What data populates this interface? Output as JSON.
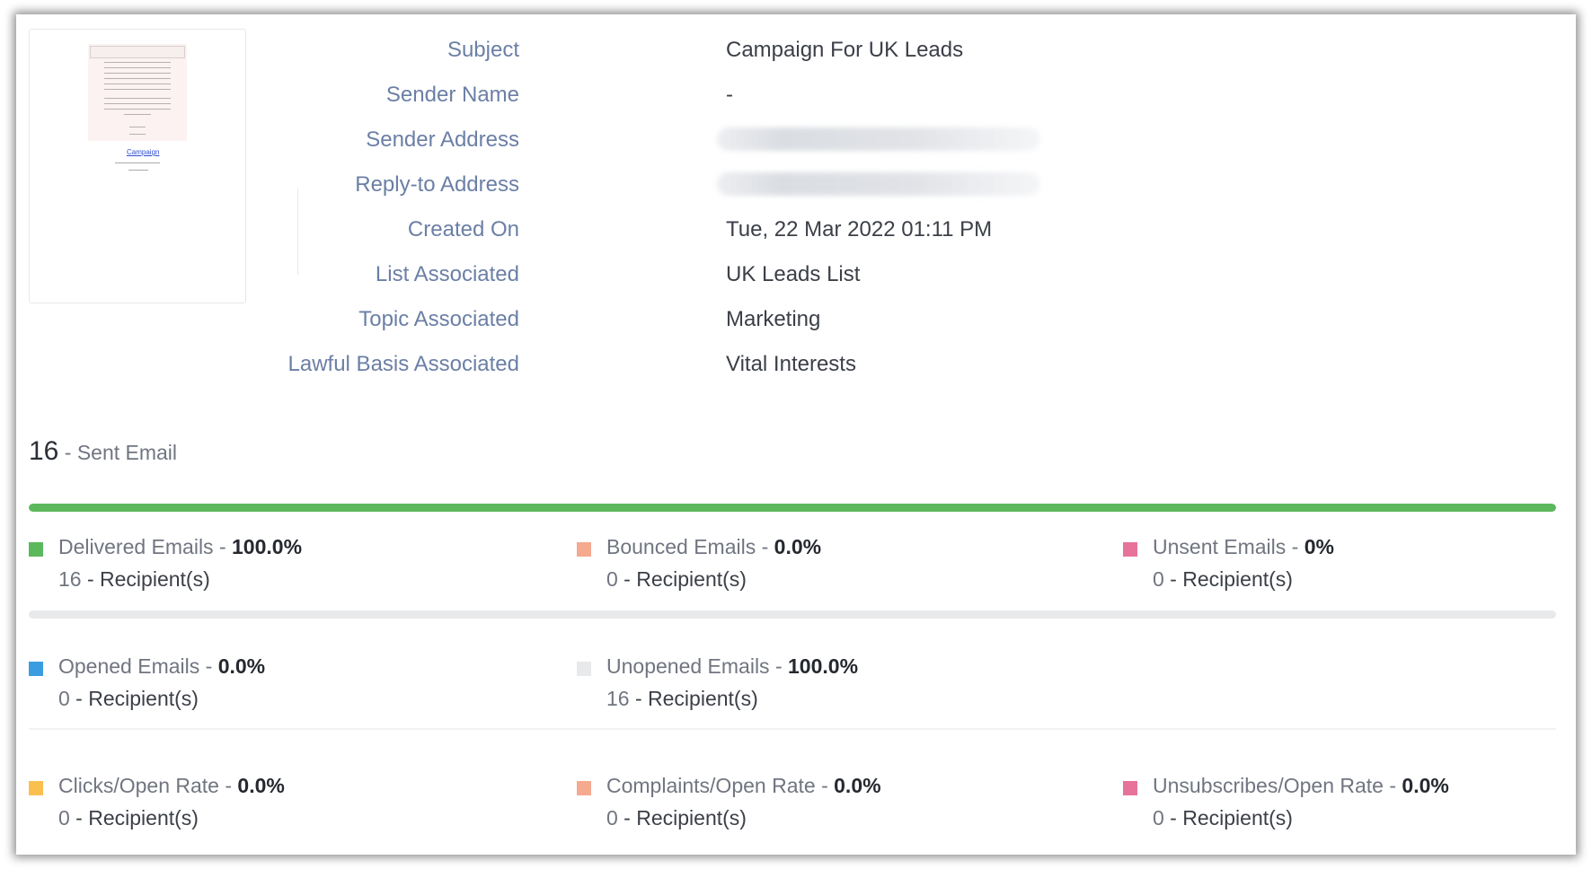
{
  "details": [
    {
      "label": "Subject",
      "value": "Campaign For UK Leads"
    },
    {
      "label": "Sender Name",
      "value": "-"
    },
    {
      "label": "Sender Address",
      "value": ""
    },
    {
      "label": "Reply-to Address",
      "value": ""
    },
    {
      "label": "Created On",
      "value": "Tue, 22 Mar 2022 01:11 PM"
    },
    {
      "label": "List Associated",
      "value": "UK Leads List"
    },
    {
      "label": "Topic Associated",
      "value": "Marketing"
    },
    {
      "label": "Lawful Basis Associated",
      "value": "Vital Interests"
    }
  ],
  "thumbnail": {
    "link_text": "Campaign"
  },
  "sent": {
    "count": "16",
    "label": " - Sent Email"
  },
  "progress": {
    "delivered_fraction": 1.0,
    "opened_fraction": 0.0,
    "delivered_color": "#5cb85c",
    "track_color": "#e8e9eb"
  },
  "stats": {
    "separator": " - ",
    "recipient_suffix": " - Recipient(s)",
    "row1": [
      {
        "name": "Delivered Emails",
        "pct": "100.0%",
        "count": "16",
        "color": "#5cb85c"
      },
      {
        "name": "Bounced Emails",
        "pct": "0.0%",
        "count": "0",
        "color": "#f5a98f"
      },
      {
        "name": "Unsent Emails",
        "pct": "0%",
        "count": "0",
        "color": "#e8739a"
      }
    ],
    "row2": [
      {
        "name": "Opened Emails",
        "pct": "0.0%",
        "count": "0",
        "color": "#3b9de0"
      },
      {
        "name": "Unopened Emails",
        "pct": "100.0%",
        "count": "16",
        "color": "#e8e9eb"
      }
    ],
    "row3": [
      {
        "name": "Clicks/Open Rate",
        "pct": "0.0%",
        "count": "0",
        "color": "#f9c04f"
      },
      {
        "name": "Complaints/Open Rate",
        "pct": "0.0%",
        "count": "0",
        "color": "#f5a98f"
      },
      {
        "name": "Unsubscribes/Open Rate",
        "pct": "0.0%",
        "count": "0",
        "color": "#e8739a"
      }
    ]
  }
}
